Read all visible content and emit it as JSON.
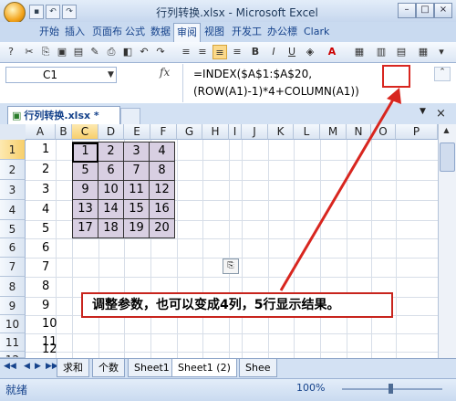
{
  "window": {
    "title": "行列转换.xlsx - Microsoft Excel"
  },
  "ribbon_tabs": [
    "开始",
    "插入",
    "页面布",
    "公式",
    "数据",
    "审阅",
    "视图",
    "开发工",
    "办公標",
    "Clark"
  ],
  "toolbar_glyphs": {
    "bold": "B",
    "italic": "I",
    "underline": "U",
    "font_color": "A"
  },
  "formula_bar": {
    "name_box": "C1",
    "fx": "fx",
    "formula": "=INDEX($A$1:$A$20,(ROW(A1)-1)*4+COLUMN(A1))"
  },
  "workbook_tab": "行列转换.xlsx *",
  "columns": [
    "A",
    "B",
    "C",
    "D",
    "E",
    "F",
    "G",
    "H",
    "I",
    "J",
    "K",
    "L",
    "M",
    "N",
    "O",
    "P"
  ],
  "rows": [
    "1",
    "2",
    "3",
    "4",
    "5",
    "6",
    "7",
    "8",
    "9",
    "10",
    "11",
    "12"
  ],
  "column_a_values": [
    "1",
    "2",
    "3",
    "4",
    "5",
    "6",
    "7",
    "8",
    "9",
    "10",
    "11",
    "12"
  ],
  "matrix": [
    [
      "1",
      "2",
      "3",
      "4"
    ],
    [
      "5",
      "6",
      "7",
      "8"
    ],
    [
      "9",
      "10",
      "11",
      "12"
    ],
    [
      "13",
      "14",
      "15",
      "16"
    ],
    [
      "17",
      "18",
      "19",
      "20"
    ]
  ],
  "callout_text": "调整参数，也可以变成4列，5行显示结果。",
  "sheet_tabs": [
    "求和",
    "个数",
    "Sheet1",
    "Sheet1 (2)",
    "Shee"
  ],
  "status": {
    "ready": "就绪",
    "zoom": "100%"
  },
  "colors": {
    "matrix_fill": "#d8cfe2",
    "highlight_red": "#d8261f",
    "ribbon_blue": "#15428b"
  }
}
